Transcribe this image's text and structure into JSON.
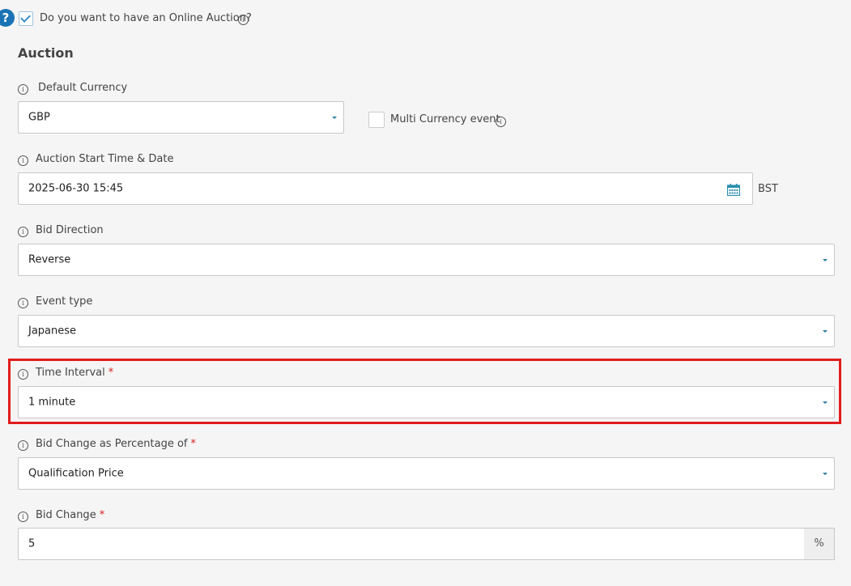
{
  "online_auction": {
    "question": "Do you want to have an Online Auction?",
    "checked": true
  },
  "help_badge": "?",
  "section_title": "Auction",
  "default_currency": {
    "label": "Default Currency",
    "value": "GBP"
  },
  "multi_currency": {
    "label": "Multi Currency event",
    "checked": false
  },
  "start_time": {
    "label": "Auction Start Time & Date",
    "value": "2025-06-30 15:45",
    "timezone": "BST"
  },
  "bid_direction": {
    "label": "Bid Direction",
    "value": "Reverse"
  },
  "event_type": {
    "label": "Event type",
    "value": "Japanese"
  },
  "time_interval": {
    "label": "Time Interval",
    "required_mark": "*",
    "value": "1 minute"
  },
  "bid_change_percentage_of": {
    "label": "Bid Change as Percentage of",
    "required_mark": "*",
    "value": "Qualification Price"
  },
  "bid_change": {
    "label": "Bid Change",
    "required_mark": "*",
    "value": "5",
    "unit": "%"
  },
  "info_glyph": "i",
  "colors": {
    "accent": "#1a73b5",
    "highlight": "#e21c1c",
    "required": "#d9211e",
    "caret": "#2a7f9a"
  }
}
